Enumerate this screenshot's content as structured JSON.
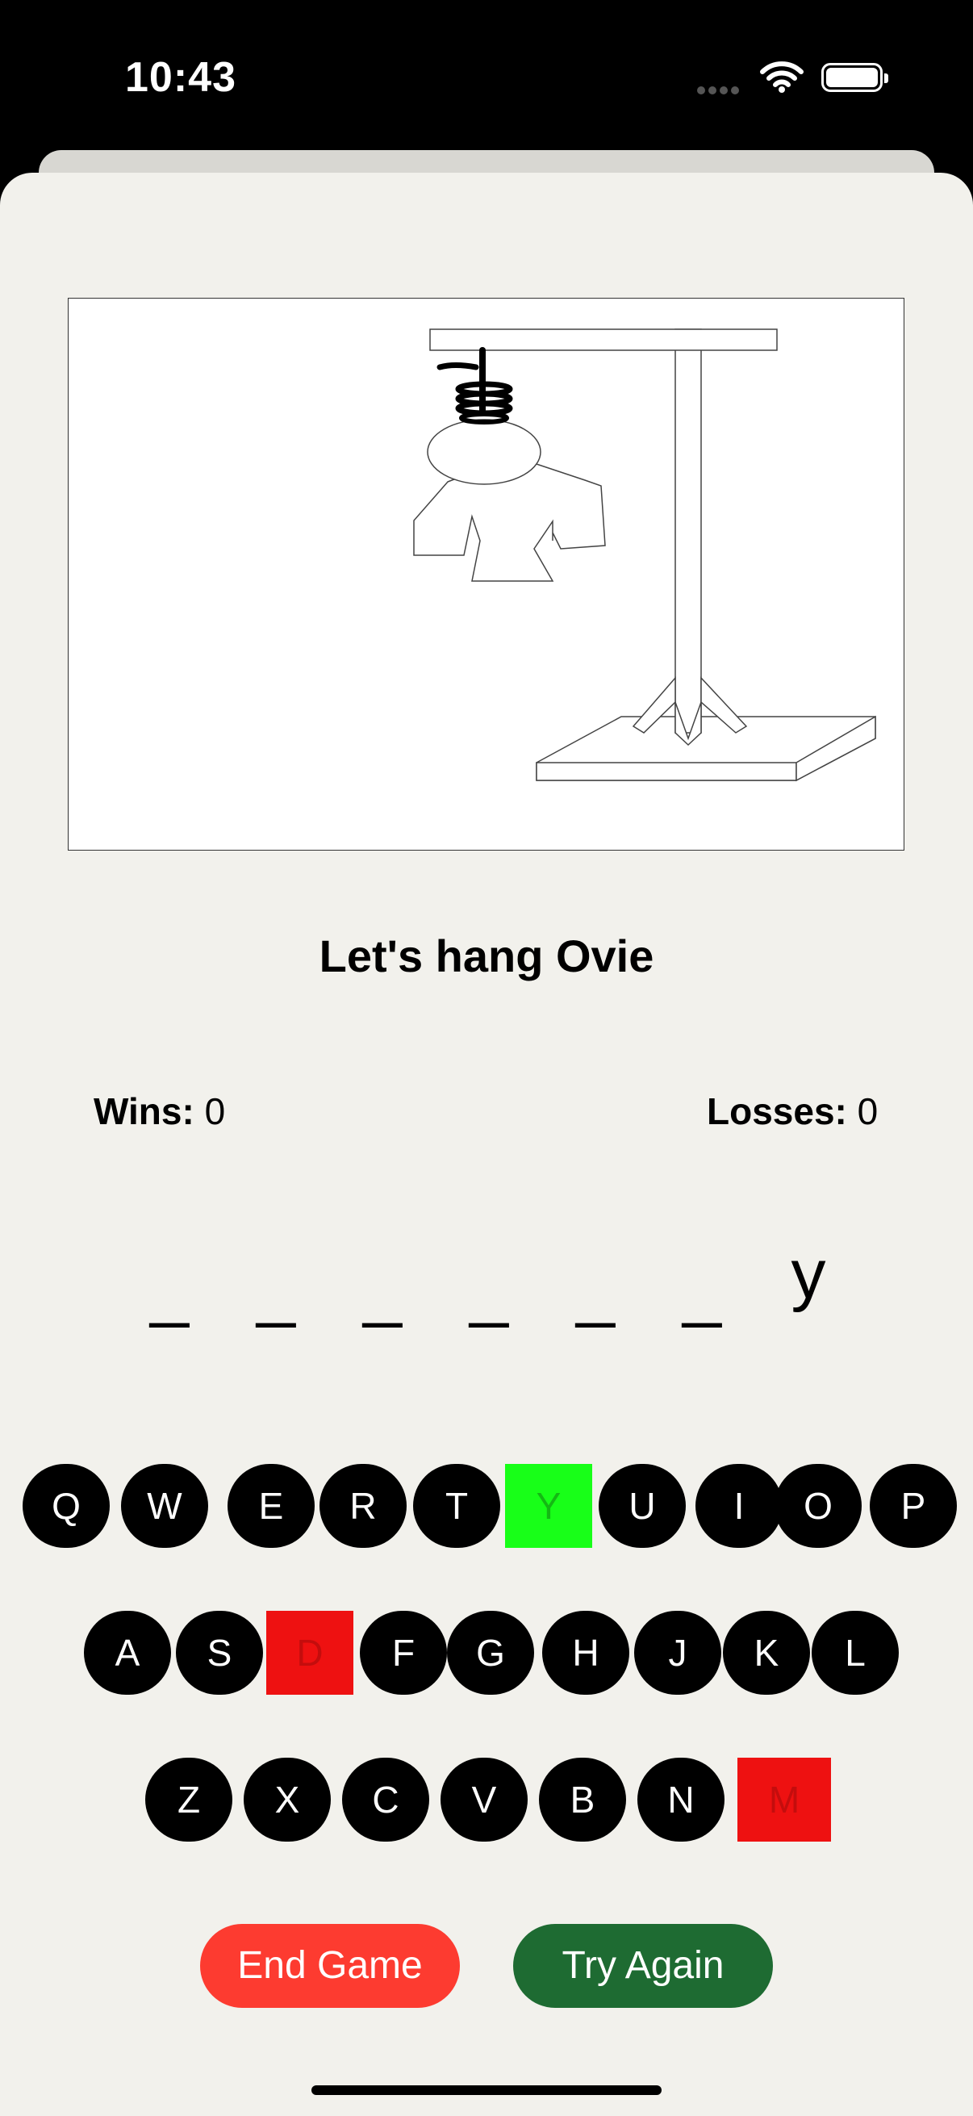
{
  "status_bar": {
    "time": "10:43"
  },
  "game": {
    "title": "Let's hang Ovie",
    "wins_label": "Wins:",
    "wins_value": "0",
    "losses_label": "Losses:",
    "losses_value": "0"
  },
  "word_slots": [
    "_",
    "_",
    "_",
    "_",
    "_",
    "_",
    "y"
  ],
  "keyboard": {
    "row1": [
      {
        "letter": "Q",
        "state": "unused"
      },
      {
        "letter": "W",
        "state": "unused"
      },
      {
        "letter": "E",
        "state": "unused"
      },
      {
        "letter": "R",
        "state": "unused"
      },
      {
        "letter": "T",
        "state": "unused"
      },
      {
        "letter": "Y",
        "state": "correct"
      },
      {
        "letter": "U",
        "state": "unused"
      },
      {
        "letter": "I",
        "state": "unused"
      },
      {
        "letter": "O",
        "state": "unused"
      },
      {
        "letter": "P",
        "state": "unused"
      }
    ],
    "row2": [
      {
        "letter": "A",
        "state": "unused"
      },
      {
        "letter": "S",
        "state": "unused"
      },
      {
        "letter": "D",
        "state": "wrong"
      },
      {
        "letter": "F",
        "state": "unused"
      },
      {
        "letter": "G",
        "state": "unused"
      },
      {
        "letter": "H",
        "state": "unused"
      },
      {
        "letter": "J",
        "state": "unused"
      },
      {
        "letter": "K",
        "state": "unused"
      },
      {
        "letter": "L",
        "state": "unused"
      }
    ],
    "row3": [
      {
        "letter": "Z",
        "state": "unused"
      },
      {
        "letter": "X",
        "state": "unused"
      },
      {
        "letter": "C",
        "state": "unused"
      },
      {
        "letter": "V",
        "state": "unused"
      },
      {
        "letter": "B",
        "state": "unused"
      },
      {
        "letter": "N",
        "state": "unused"
      },
      {
        "letter": "M",
        "state": "wrong"
      }
    ]
  },
  "buttons": {
    "end_game": "End Game",
    "try_again": "Try Again"
  },
  "colors": {
    "correct": "#18ff18",
    "wrong": "#ee1111",
    "end_game": "#fd3b30",
    "try_again": "#1e6b32"
  },
  "icons": [
    "cellular-signal-icon",
    "wifi-icon",
    "battery-icon",
    "gallows-hangman-image"
  ]
}
